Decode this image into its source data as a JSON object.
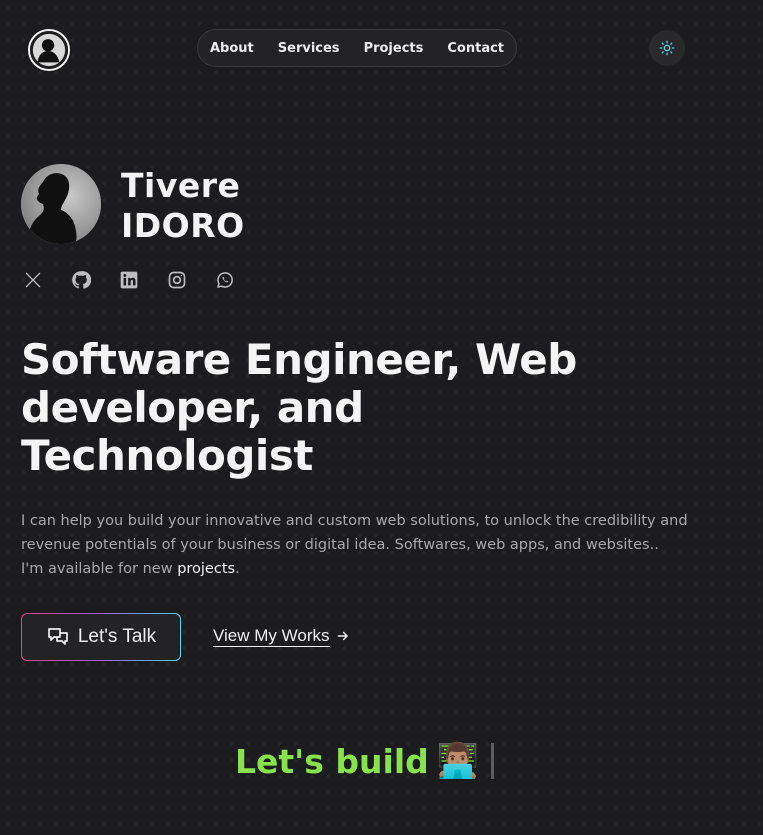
{
  "header": {
    "logo_icon": "avatar-silhouette-icon",
    "nav": [
      {
        "label": "About"
      },
      {
        "label": "Services"
      },
      {
        "label": "Projects"
      },
      {
        "label": "Contact"
      }
    ],
    "theme_toggle_icon": "sun-icon"
  },
  "profile": {
    "first_name": "Tivere",
    "last_name": "IDORO",
    "avatar_icon": "profile-photo-silhouette",
    "socials": [
      {
        "icon": "x-twitter-icon"
      },
      {
        "icon": "github-icon"
      },
      {
        "icon": "linkedin-icon"
      },
      {
        "icon": "instagram-icon"
      },
      {
        "icon": "whatsapp-icon"
      }
    ]
  },
  "hero": {
    "headline_line1": "Software Engineer, Web",
    "headline_line2": "developer, and",
    "headline_line3": "Technologist",
    "intro_line1": "I can help you build your innovative and custom web solutions, to unlock the credibility and",
    "intro_line2": "revenue potentials of your business or digital idea. Softwares, web apps, and websites..",
    "intro_line3_prefix": "I'm available for new ",
    "intro_link": "projects",
    "intro_line3_suffix": ".",
    "cta_talk": "Let's Talk",
    "cta_works": "View My Works",
    "typing_text": "Let's build",
    "typing_emoji": "👨🏽‍💻"
  },
  "colors": {
    "background": "#1c1b1d",
    "accent_green": "#88e24e",
    "accent_cyan": "#51d4ec",
    "accent_pink": "#e0437f"
  }
}
